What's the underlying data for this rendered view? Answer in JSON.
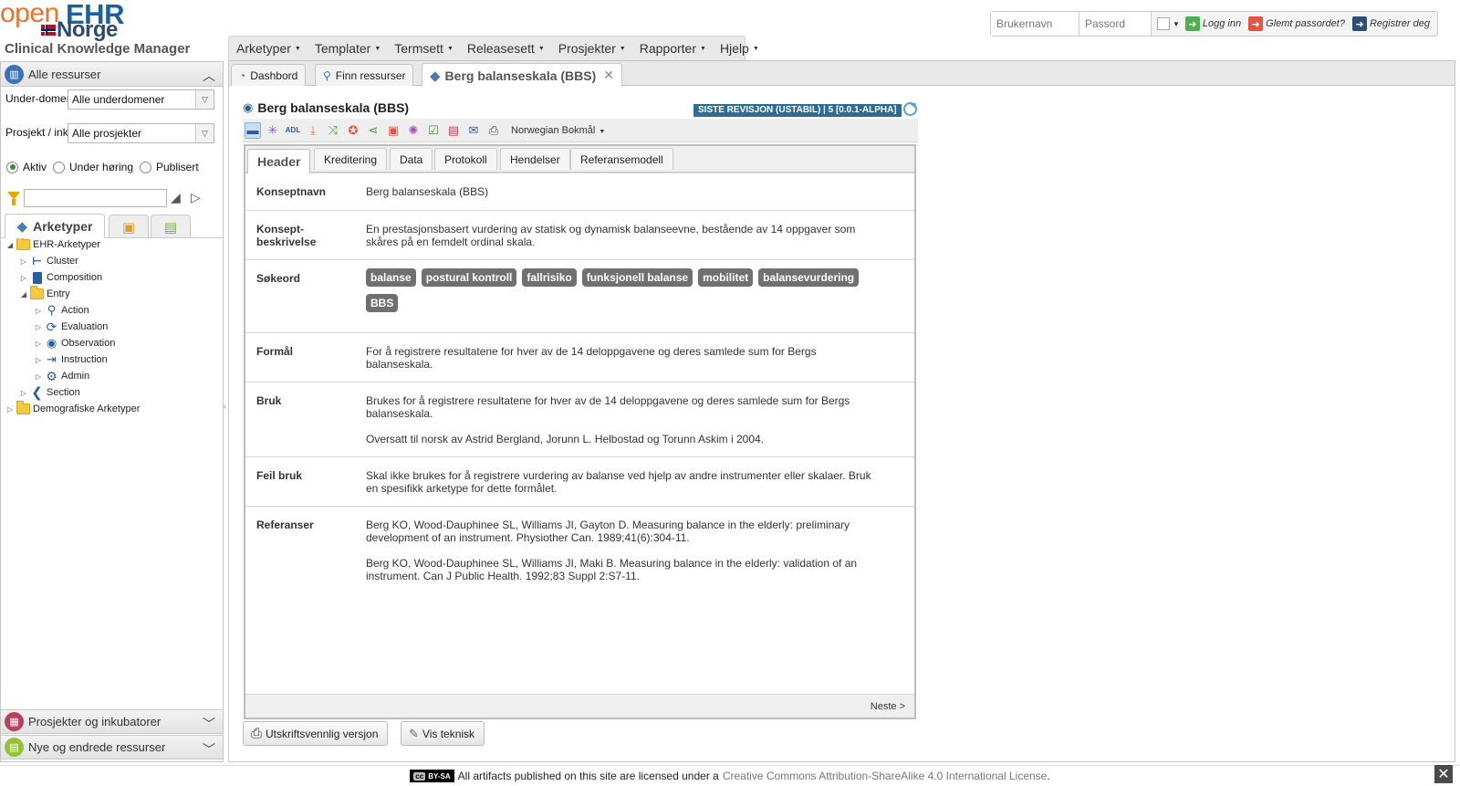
{
  "brand": {
    "open": "open",
    "ehr": "EHR",
    "norge": "Norge",
    "subtitle": "Clinical Knowledge Manager"
  },
  "login": {
    "username_placeholder": "Brukernavn",
    "password_placeholder": "Passord",
    "login_label": "Logg inn",
    "forgot_label": "Glemt passordet?",
    "register_label": "Registrer deg"
  },
  "menu": [
    "Arketyper",
    "Templater",
    "Termsett",
    "Releasesett",
    "Prosjekter",
    "Rapporter",
    "Hjelp"
  ],
  "left": {
    "panel_title": "Alle ressurser",
    "subdomain_label": "Under-domene:",
    "subdomain_value": "Alle underdomener",
    "project_label": "Prosjekt / inkubator:",
    "project_value": "Alle prosjekter",
    "radios": [
      {
        "label": "Aktiv",
        "checked": true
      },
      {
        "label": "Under høring",
        "checked": false
      },
      {
        "label": "Publisert",
        "checked": false
      }
    ],
    "tab_archetypes": "Arketyper",
    "tree": {
      "ehr": "EHR-Arketyper",
      "cluster": "Cluster",
      "composition": "Composition",
      "entry": "Entry",
      "action": "Action",
      "evaluation": "Evaluation",
      "observation": "Observation",
      "instruction": "Instruction",
      "admin": "Admin",
      "section": "Section",
      "demographic": "Demografiske Arketyper"
    },
    "panel_projects": "Prosjekter og inkubatorer",
    "panel_new": "Nye og endrede ressurser"
  },
  "main": {
    "tab_dashboard": "Dashbord",
    "tab_find": "Finn ressurser",
    "tab_current": "Berg balanseskala (BBS)",
    "title": "Berg balanseskala (BBS)",
    "revision": "SISTE REVISJON (USTABIL) | 5 [0.0.1-ALPHA]",
    "language": "Norwegian Bokmål",
    "subtabs": [
      "Header",
      "Kreditering",
      "Data",
      "Protokoll",
      "Hendelser",
      "Referansemodell"
    ],
    "rows": {
      "concept_label": "Konseptnavn",
      "concept_value": "Berg balanseskala (BBS)",
      "desc_label": "Konsept-beskrivelse",
      "desc_value": "En prestasjonsbasert vurdering av statisk og dynamisk balanseevne, bestående av 14 oppgaver som skåres på en femdelt ordinal skala.",
      "keywords_label": "Søkeord",
      "keywords": [
        "balanse",
        "postural kontroll",
        "fallrisiko",
        "funksjonell balanse",
        "mobilitet",
        "balansevurdering",
        "BBS"
      ],
      "purpose_label": "Formål",
      "purpose_value": "For å registrere resultatene for hver av de 14 deloppgavene og deres samlede sum for Bergs balanseskala.",
      "use_label": "Bruk",
      "use_value_1": "Brukes for å registrere resultatene for hver av de 14 deloppgavene og deres samlede sum for Bergs balanseskala.",
      "use_value_2": "Oversatt til norsk av Astrid Bergland, Jorunn L. Helbostad og Torunn Askim i 2004.",
      "misuse_label": "Feil bruk",
      "misuse_value": "Skal ikke brukes for å registrere vurdering av balanse ved hjelp av andre instrumenter eller skalaer. Bruk en spesifikk arketype for dette formålet.",
      "refs_label": "Referanser",
      "ref_1": "Berg KO, Wood-Dauphinee SL, Williams JI, Gayton D. Measuring balance in the elderly: preliminary development of an instrument. Physiother Can. 1989;41(6):304-11.",
      "ref_2": "Berg KO, Wood-Dauphinee SL, Williams JI, Maki B. Measuring balance in the elderly: validation of an instrument. Can J Public Health. 1992;83 Suppl 2:S7-11."
    },
    "next": "Neste >",
    "print_button": "Utskriftsvennlig versjon",
    "technical_button": "Vis teknisk"
  },
  "license": {
    "badge": "BY-SA",
    "text": "All artifacts published on this site are licensed under a",
    "link": "Creative Commons Attribution-ShareAlike 4.0 International License",
    "period": "."
  },
  "colors": {
    "accent_blue": "#2e6d93",
    "tag_gray": "#707070",
    "orange": "#e5762e"
  }
}
